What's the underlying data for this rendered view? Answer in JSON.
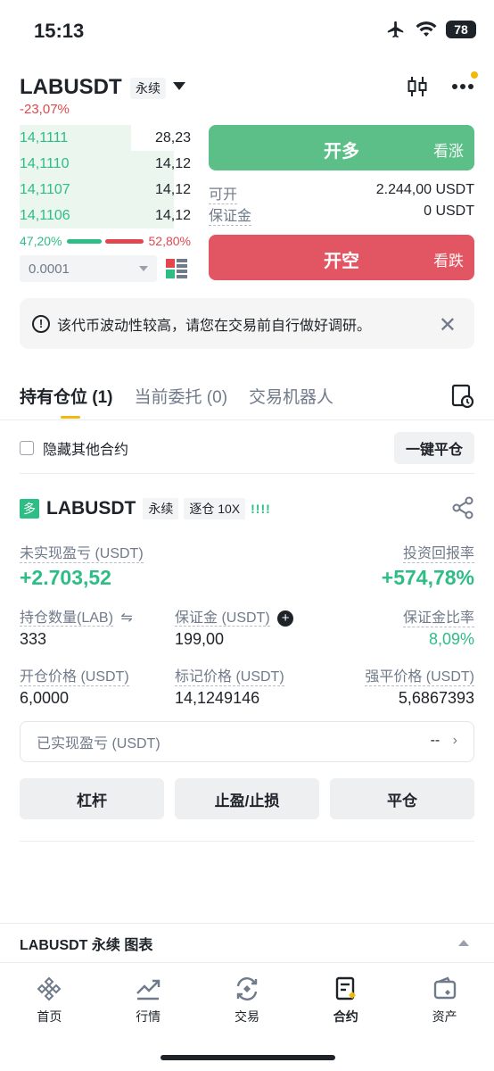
{
  "status": {
    "time": "15:13",
    "battery": "78"
  },
  "header": {
    "symbol": "LABUSDT",
    "type_tag": "永续",
    "change": "-23,07%"
  },
  "orderbook": {
    "rows": [
      {
        "price": "14,1111",
        "qty": "28,23",
        "depth": 0.65
      },
      {
        "price": "14,1110",
        "qty": "14,12",
        "depth": 0.9
      },
      {
        "price": "14,1107",
        "qty": "14,12",
        "depth": 0.9
      },
      {
        "price": "14,1106",
        "qty": "14,12",
        "depth": 0.9
      }
    ],
    "buy_ratio": "47,20%",
    "sell_ratio": "52,80%",
    "buy_fraction": 0.472,
    "precision": "0.0001"
  },
  "trade": {
    "long_label": "开多",
    "long_sub": "看涨",
    "available_label": "可开",
    "available_value": "2.244,00 USDT",
    "margin_label": "保证金",
    "margin_value": "0 USDT",
    "short_label": "开空",
    "short_sub": "看跌"
  },
  "notice": {
    "text": "该代币波动性较高，请您在交易前自行做好调研。"
  },
  "tabs": [
    {
      "label": "持有仓位 (1)"
    },
    {
      "label": "当前委托 (0)"
    },
    {
      "label": "交易机器人"
    }
  ],
  "positions": {
    "hide_label": "隐藏其他合约",
    "close_all": "一键平仓",
    "item": {
      "badge": "多",
      "symbol": "LABUSDT",
      "type_tag": "永续",
      "margin_tag": "逐仓 10X",
      "risk": "!!!!",
      "unrealized_label": "未实现盈亏 (USDT)",
      "unrealized_value": "+2.703,52",
      "roi_label": "投资回报率",
      "roi_value": "+574,78%",
      "size_label": "持仓数量(LAB)",
      "size_value": "333",
      "margin_label": "保证金 (USDT)",
      "margin_value": "199,00",
      "margin_ratio_label": "保证金比率",
      "margin_ratio_value": "8,09%",
      "entry_label": "开仓价格 (USDT)",
      "entry_value": "6,0000",
      "mark_label": "标记价格 (USDT)",
      "mark_value": "14,1249146",
      "liq_label": "强平价格 (USDT)",
      "liq_value": "5,6867393",
      "realized_label": "已实现盈亏 (USDT)",
      "realized_value": "--",
      "actions": [
        "杠杆",
        "止盈/止损",
        "平仓"
      ]
    }
  },
  "chart_bar": {
    "label": "LABUSDT 永续 图表"
  },
  "nav": [
    {
      "label": "首页"
    },
    {
      "label": "行情"
    },
    {
      "label": "交易"
    },
    {
      "label": "合约"
    },
    {
      "label": "资产"
    }
  ],
  "colors": {
    "green": "#2ebd85",
    "red": "#e0474f",
    "accent": "#f0b90b"
  }
}
